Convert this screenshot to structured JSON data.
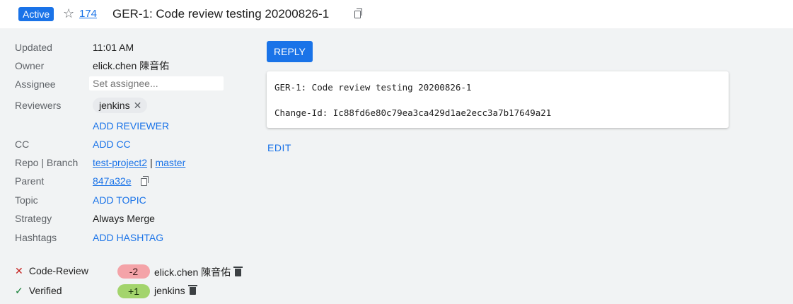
{
  "header": {
    "status_badge": "Active",
    "star_glyph": "☆",
    "change_number": "174",
    "subject": "GER-1: Code review testing 20200826-1"
  },
  "meta": {
    "updated": {
      "label": "Updated",
      "value": "11:01 AM"
    },
    "owner": {
      "label": "Owner",
      "value": "elick.chen 陳音佑"
    },
    "assignee": {
      "label": "Assignee",
      "placeholder": "Set assignee..."
    },
    "reviewers": {
      "label": "Reviewers",
      "chip": "jenkins",
      "remove_glyph": "✕",
      "add_label": "ADD REVIEWER"
    },
    "cc": {
      "label": "CC",
      "add_label": "ADD CC"
    },
    "repo_branch": {
      "label": "Repo | Branch",
      "repo": "test-project2",
      "separator": "|",
      "branch": "master"
    },
    "parent": {
      "label": "Parent",
      "value": "847a32e"
    },
    "topic": {
      "label": "Topic",
      "add_label": "ADD TOPIC"
    },
    "strategy": {
      "label": "Strategy",
      "value": "Always Merge"
    },
    "hashtags": {
      "label": "Hashtags",
      "add_label": "ADD HASHTAG"
    }
  },
  "labels": [
    {
      "name": "Code-Review",
      "mark": "✕",
      "vote": "-2",
      "voter": "elick.chen 陳音佑"
    },
    {
      "name": "Verified",
      "mark": "✓",
      "vote": "+1",
      "voter": "jenkins"
    }
  ],
  "actions": {
    "reply": "REPLY",
    "edit": "EDIT"
  },
  "commit_message": {
    "line1": "GER-1: Code review testing 20200826-1",
    "line2": "Change-Id: Ic88fd6e80c79ea3ca429d1ae2ecc3a7b17649a21"
  },
  "colors": {
    "accent": "#1a73e8",
    "negative_vote": "#f4a3a8",
    "positive_vote": "#a3d46c"
  }
}
